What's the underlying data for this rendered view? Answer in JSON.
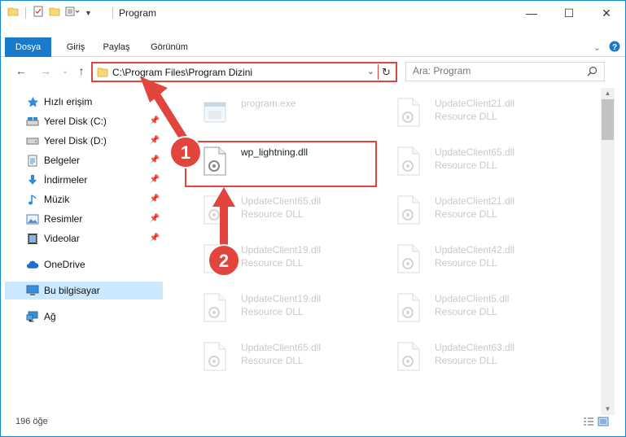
{
  "window": {
    "title": "Program",
    "controls": {
      "minimize": "—",
      "maximize": "☐",
      "close": "✕"
    }
  },
  "ribbon": {
    "tabs": [
      "Dosya",
      "Giriş",
      "Paylaş",
      "Görünüm"
    ],
    "accent_color": "#1979ca"
  },
  "address_bar": {
    "path": "C:\\Program Files\\Program Dizini",
    "refresh_icon": "↻"
  },
  "search": {
    "placeholder": "Ara: Program"
  },
  "sidebar": {
    "items": [
      {
        "label": "Hızlı erişim",
        "icon": "star-icon",
        "pinned": false
      },
      {
        "label": "Yerel Disk (C:)",
        "icon": "drive-icon",
        "pinned": true
      },
      {
        "label": "Yerel Disk (D:)",
        "icon": "drive-icon",
        "pinned": true
      },
      {
        "label": "Belgeler",
        "icon": "documents-icon",
        "pinned": true
      },
      {
        "label": "İndirmeler",
        "icon": "download-icon",
        "pinned": true
      },
      {
        "label": "Müzik",
        "icon": "music-icon",
        "pinned": true
      },
      {
        "label": "Resimler",
        "icon": "pictures-icon",
        "pinned": true
      },
      {
        "label": "Videolar",
        "icon": "videos-icon",
        "pinned": true
      },
      {
        "label": "OneDrive",
        "icon": "cloud-icon",
        "pinned": false
      },
      {
        "label": "Bu bilgisayar",
        "icon": "computer-icon",
        "pinned": false,
        "selected": true
      },
      {
        "label": "Ağ",
        "icon": "network-icon",
        "pinned": false
      }
    ]
  },
  "files": [
    {
      "name": "program.exe",
      "sub": "",
      "faded": true
    },
    {
      "name": "UpdateClient21.dll",
      "sub": "Resource DLL",
      "faded": true
    },
    {
      "name": "wp_lightning.dll",
      "sub": "",
      "faded": false
    },
    {
      "name": "UpdateClient65.dll",
      "sub": "Resource DLL",
      "faded": true
    },
    {
      "name": "UpdateClient65.dll",
      "sub": "Resource DLL",
      "faded": true
    },
    {
      "name": "UpdateClient21.dll",
      "sub": "Resource DLL",
      "faded": true
    },
    {
      "name": "UpdateClient19.dll",
      "sub": "Resource DLL",
      "faded": true
    },
    {
      "name": "UpdateClient42.dll",
      "sub": "Resource DLL",
      "faded": true
    },
    {
      "name": "UpdateClient19.dll",
      "sub": "Resource DLL",
      "faded": true
    },
    {
      "name": "UpdateClient5.dll",
      "sub": "Resource DLL",
      "faded": true
    },
    {
      "name": "UpdateClient65.dll",
      "sub": "Resource DLL",
      "faded": true
    },
    {
      "name": "UpdateClient63.dll",
      "sub": "Resource DLL",
      "faded": true
    }
  ],
  "status": {
    "item_count": "196 öğe"
  },
  "annotations": {
    "step1": "1",
    "step2": "2",
    "color": "#e2453d"
  }
}
